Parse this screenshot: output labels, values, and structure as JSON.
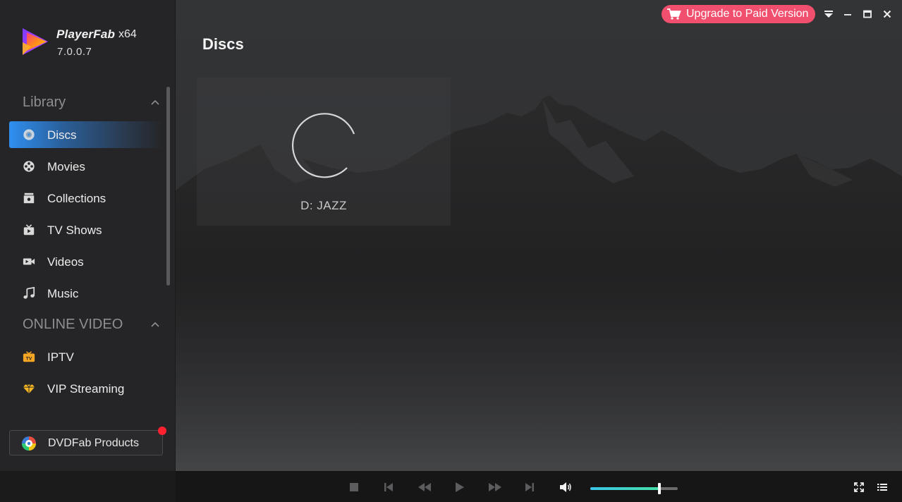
{
  "app": {
    "name": "PlayerFab",
    "arch": "x64",
    "version": "7.0.0.7"
  },
  "sidebar": {
    "library_header": "Library",
    "online_header": "ONLINE VIDEO",
    "library_items": [
      {
        "label": "Discs",
        "icon": "disc-icon",
        "active": true
      },
      {
        "label": "Movies",
        "icon": "film-reel-icon",
        "active": false
      },
      {
        "label": "Collections",
        "icon": "collection-box-icon",
        "active": false
      },
      {
        "label": "TV Shows",
        "icon": "tv-icon",
        "active": false
      },
      {
        "label": "Videos",
        "icon": "video-camera-icon",
        "active": false
      },
      {
        "label": "Music",
        "icon": "music-note-icon",
        "active": false
      }
    ],
    "online_items": [
      {
        "label": "IPTV",
        "icon": "iptv-icon"
      },
      {
        "label": "VIP Streaming",
        "icon": "diamond-icon"
      }
    ],
    "dvdfab_button": "DVDFab Products"
  },
  "header": {
    "upgrade_label": "Upgrade to Paid Version"
  },
  "main": {
    "title": "Discs",
    "disc_label": "D: JAZZ"
  },
  "player": {
    "volume_level": 0.79
  },
  "colors": {
    "accent": "#2f8ff0",
    "upgrade": "#f0506e",
    "notification": "#ff2030",
    "volume_start": "#3cc5e8",
    "volume_end": "#46e0a8"
  }
}
